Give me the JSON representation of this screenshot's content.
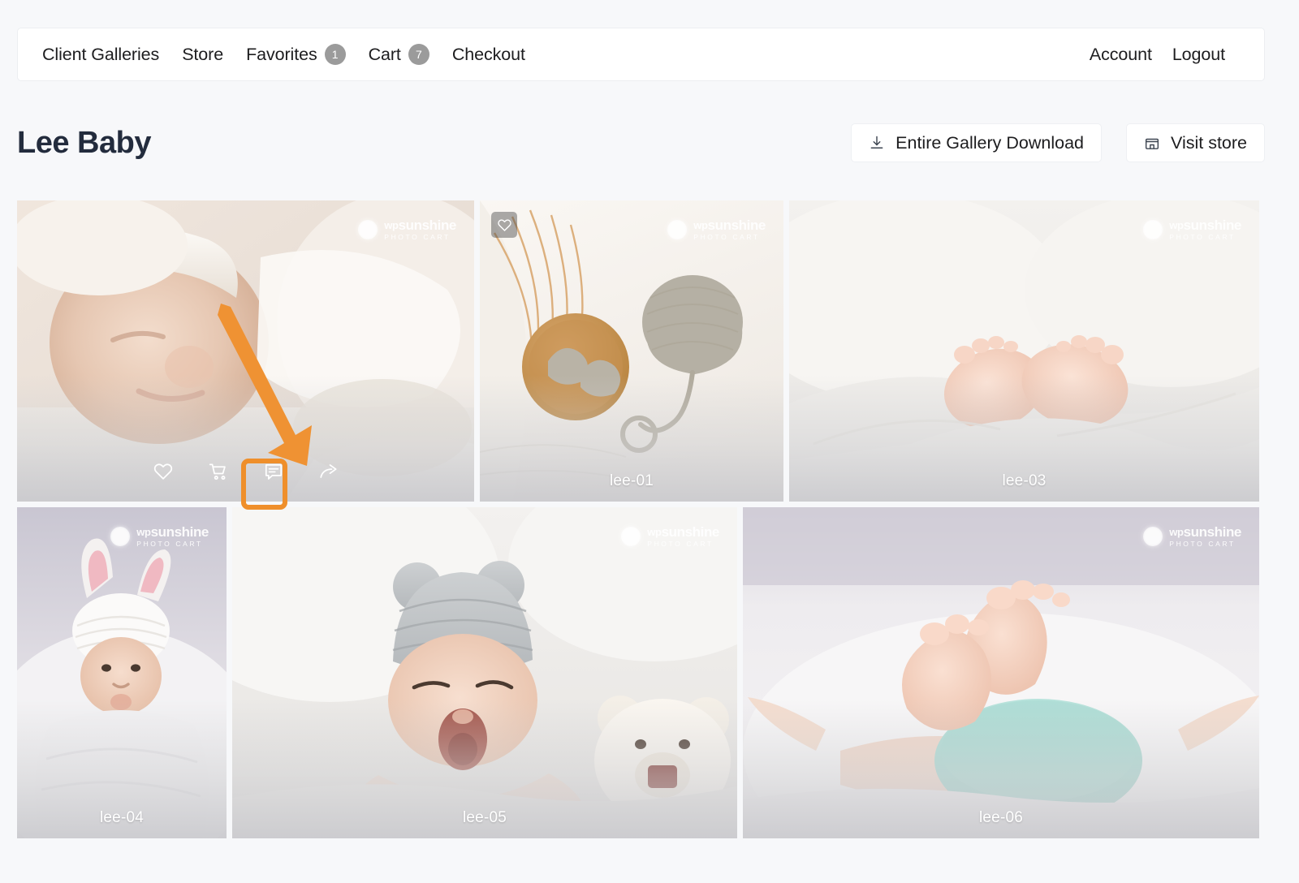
{
  "nav": {
    "left_items": [
      {
        "label": "Client Galleries",
        "badge": null,
        "name": "nav-client-galleries"
      },
      {
        "label": "Store",
        "badge": null,
        "name": "nav-store"
      },
      {
        "label": "Favorites",
        "badge": "1",
        "name": "nav-favorites"
      },
      {
        "label": "Cart",
        "badge": "7",
        "name": "nav-cart"
      },
      {
        "label": "Checkout",
        "badge": null,
        "name": "nav-checkout"
      }
    ],
    "right_items": [
      {
        "label": "Account",
        "name": "nav-account"
      },
      {
        "label": "Logout",
        "name": "nav-logout"
      }
    ]
  },
  "header": {
    "title": "Lee Baby",
    "download_button": {
      "label": "Entire Gallery Download",
      "icon": "download-icon"
    },
    "store_button": {
      "label": "Visit store",
      "icon": "store-icon"
    }
  },
  "watermark": {
    "brand_small": "wp",
    "brand_main": "sunshine",
    "tagline": "PHOTO CART",
    "icon": "sun-icon"
  },
  "gallery": {
    "row1": [
      {
        "caption": "",
        "name": "gallery-tile-1",
        "has_actionbar": true,
        "has_fav": false
      },
      {
        "caption": "lee-01",
        "name": "gallery-tile-lee-01",
        "has_actionbar": false,
        "has_fav": true
      },
      {
        "caption": "lee-03",
        "name": "gallery-tile-lee-03",
        "has_actionbar": false,
        "has_fav": false
      }
    ],
    "row2": [
      {
        "caption": "lee-04",
        "name": "gallery-tile-lee-04",
        "has_actionbar": false,
        "has_fav": false
      },
      {
        "caption": "lee-05",
        "name": "gallery-tile-lee-05",
        "has_actionbar": false,
        "has_fav": false
      },
      {
        "caption": "lee-06",
        "name": "gallery-tile-lee-06",
        "has_actionbar": false,
        "has_fav": false
      }
    ]
  },
  "tile_actions": [
    {
      "icon": "heart-icon",
      "name": "favorite-action"
    },
    {
      "icon": "cart-icon",
      "name": "add-to-cart-action"
    },
    {
      "icon": "comment-icon",
      "name": "comment-action"
    },
    {
      "icon": "share-icon",
      "name": "share-action"
    }
  ],
  "annotation": {
    "highlight_color": "#ef8f2b",
    "arrow_color": "#ef9233",
    "target": "comment-action"
  },
  "colors": {
    "page_background": "#f7f8fa",
    "surface": "#ffffff",
    "text": "#1d1d1f",
    "title": "#232c3d",
    "badge": "#9b9b9b",
    "border": "#eceef1"
  }
}
